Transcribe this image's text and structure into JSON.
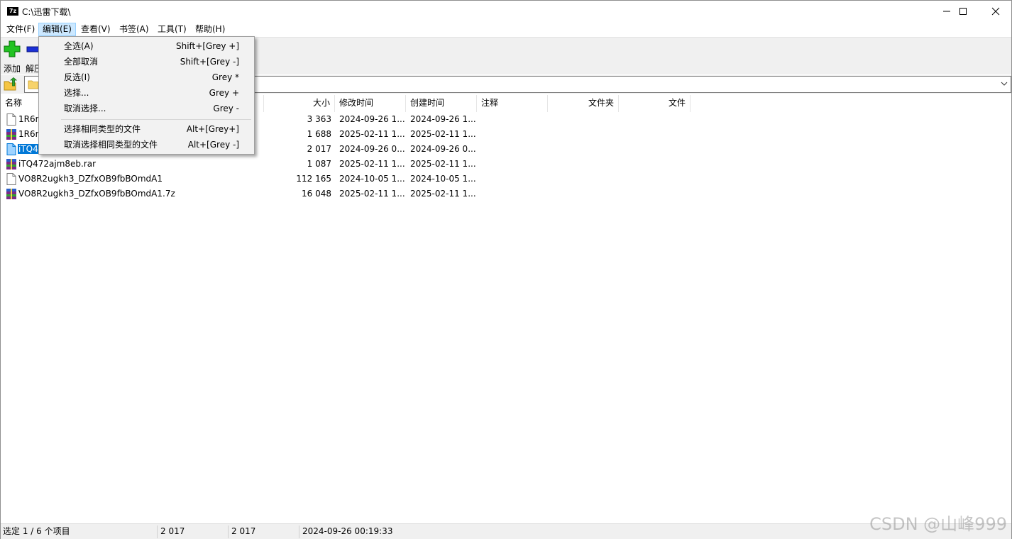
{
  "window": {
    "title": "C:\\迅雷下载\\",
    "app_icon_text": "7z"
  },
  "menubar": {
    "items": [
      "文件(F)",
      "编辑(E)",
      "查看(V)",
      "书签(A)",
      "工具(T)",
      "帮助(H)"
    ],
    "active_index": 1
  },
  "toolbar": {
    "add_label": "添加",
    "extract_label": "解压"
  },
  "columns": {
    "name": "名称",
    "size": "大小",
    "modified": "修改时间",
    "created": "创建时间",
    "comment": "注释",
    "folders": "文件夹",
    "files": "文件"
  },
  "files": [
    {
      "name": "1R6n",
      "size": "3 363",
      "modified": "2024-09-26 1...",
      "created": "2024-09-26 1...",
      "type": "file"
    },
    {
      "name": "1R6n",
      "size": "1 688",
      "modified": "2025-02-11 1...",
      "created": "2025-02-11 1...",
      "type": "archive"
    },
    {
      "name": "iTQ4",
      "size": "2 017",
      "modified": "2024-09-26 0...",
      "created": "2024-09-26 0...",
      "type": "file-selected"
    },
    {
      "name": "iTQ472ajm8eb.rar",
      "size": "1 087",
      "modified": "2025-02-11 1...",
      "created": "2025-02-11 1...",
      "type": "archive"
    },
    {
      "name": "VO8R2ugkh3_DZfxOB9fbBOmdA1",
      "size": "112 165",
      "modified": "2024-10-05 1...",
      "created": "2024-10-05 1...",
      "type": "file"
    },
    {
      "name": "VO8R2ugkh3_DZfxOB9fbBOmdA1.7z",
      "size": "16 048",
      "modified": "2025-02-11 1...",
      "created": "2025-02-11 1...",
      "type": "archive"
    }
  ],
  "edit_menu": {
    "items": [
      {
        "label": "全选(A)",
        "shortcut": "Shift+[Grey +]"
      },
      {
        "label": "全部取消",
        "shortcut": "Shift+[Grey -]"
      },
      {
        "label": "反选(I)",
        "shortcut": "Grey *"
      },
      {
        "label": "选择...",
        "shortcut": "Grey +"
      },
      {
        "label": "取消选择...",
        "shortcut": "Grey -"
      },
      {
        "label": "选择相同类型的文件",
        "shortcut": "Alt+[Grey+]"
      },
      {
        "label": "取消选择相同类型的文件",
        "shortcut": "Alt+[Grey -]"
      }
    ]
  },
  "statusbar": {
    "selection": "选定 1 / 6 个项目",
    "size": "2 017",
    "packed_size": "2 017",
    "date": "2024-09-26 00:19:33"
  },
  "watermark": "CSDN @山峰999",
  "colors": {
    "selection": "#0078d7",
    "menu_highlight": "#cce8ff",
    "toolbar_bg": "#f0f0f0"
  }
}
